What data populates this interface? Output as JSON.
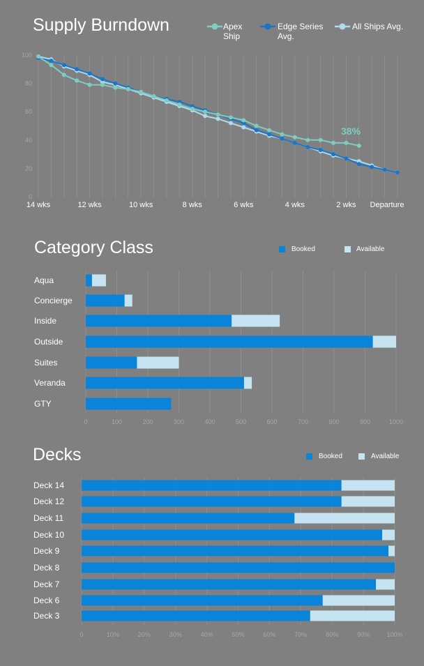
{
  "colors": {
    "background": "#808080",
    "apex": "#7ecdc0",
    "edge": "#1b75c9",
    "all_ships": "#aedbee",
    "booked": "#0984d8",
    "available": "#c5e3f1",
    "grid": "#8e8e8e",
    "tick_text": "#a7a7a7",
    "label_text": "#ffffff"
  },
  "icons": {
    "legend_line_marker": "circle-line-icon",
    "legend_bar_marker": "square-icon"
  },
  "burndown": {
    "title": "Supply Burndown",
    "callout": "38%",
    "legend": [
      {
        "label_line1": "Apex",
        "label_line2": "Ship"
      },
      {
        "label_line1": "Edge Series",
        "label_line2": "Avg."
      },
      {
        "label_line1": "All Ships Avg.",
        "label_line2": ""
      }
    ]
  },
  "category": {
    "title": "Category Class",
    "legend": {
      "booked": "Booked",
      "available": "Available"
    }
  },
  "decks": {
    "title": "Decks",
    "legend": {
      "booked": "Booked",
      "available": "Available"
    }
  },
  "chart_data": [
    {
      "type": "line",
      "title": "Supply Burndown",
      "x_ticks": [
        "14 wks",
        "12 wks",
        "10 wks",
        "8 wks",
        "6 wks",
        "4 wks",
        "2 wks",
        "Departure"
      ],
      "ylim": [
        0,
        100
      ],
      "y_ticks": [
        0,
        20,
        40,
        60,
        80,
        100
      ],
      "x_unit": "weeks before departure",
      "grid": "vertical",
      "annotation": "38%",
      "series": [
        {
          "name": "Apex Ship",
          "color": "#7ecdc0",
          "x": [
            14,
            13.5,
            13,
            12.5,
            12,
            11.5,
            11,
            10.5,
            10,
            9.5,
            9,
            8.5,
            8,
            7.5,
            7,
            6.5,
            6,
            5.5,
            5,
            4.5,
            4,
            3.5,
            3,
            2.5,
            2,
            1.5
          ],
          "y": [
            99,
            93,
            86,
            82,
            79,
            79,
            77,
            76,
            74,
            71,
            68,
            65,
            62,
            60,
            58,
            56,
            54,
            50,
            47,
            44,
            42,
            40,
            40,
            38,
            38,
            36
          ]
        },
        {
          "name": "Edge Series Avg.",
          "color": "#1b75c9",
          "x": [
            14,
            13.5,
            13,
            12.5,
            12,
            11.5,
            11,
            10.5,
            10,
            9.5,
            9,
            8.5,
            8,
            7.5,
            7,
            6.5,
            6,
            5.5,
            5,
            4.5,
            4,
            3.5,
            3,
            2.5,
            2,
            1.5,
            1,
            0.5,
            0
          ],
          "y": [
            98,
            96,
            93,
            90,
            87,
            83,
            80,
            77,
            74,
            71,
            69,
            67,
            64,
            61,
            58,
            55,
            52,
            47,
            44,
            41,
            38,
            35,
            33,
            30,
            27,
            23,
            21,
            19,
            17
          ]
        },
        {
          "name": "All Ships Avg.",
          "color": "#aedbee",
          "x": [
            14,
            13.5,
            13,
            12.5,
            12,
            11.5,
            11,
            10.5,
            10,
            9.5,
            9,
            8.5,
            8,
            7.5,
            7,
            6.5,
            6,
            5.5,
            5,
            4.5,
            4,
            3.5,
            3,
            2.5,
            2,
            1.5,
            1,
            0.5,
            0
          ],
          "y": [
            99,
            97,
            92,
            89,
            86,
            81,
            79,
            76,
            73,
            70,
            67,
            64,
            61,
            57,
            55,
            52,
            49,
            46,
            43,
            41,
            38,
            35,
            32,
            29,
            27,
            25,
            22,
            19,
            17
          ]
        }
      ]
    },
    {
      "type": "bar",
      "orientation": "horizontal",
      "stacked": true,
      "title": "Category Class",
      "categories": [
        "Aqua",
        "Concierge",
        "Inside",
        "Outside",
        "Suites",
        "Veranda",
        "GTY"
      ],
      "xlim": [
        0,
        1000
      ],
      "x_ticks": [
        "0",
        "100",
        "200",
        "300",
        "400",
        "500",
        "600",
        "700",
        "800",
        "900",
        "1000"
      ],
      "series": [
        {
          "name": "Booked",
          "color": "#0984d8",
          "values": [
            20,
            125,
            470,
            925,
            165,
            510,
            275
          ]
        },
        {
          "name": "Available",
          "color": "#c5e3f1",
          "values": [
            45,
            25,
            155,
            75,
            135,
            25,
            0
          ]
        }
      ]
    },
    {
      "type": "bar",
      "orientation": "horizontal",
      "stacked": true,
      "title": "Decks",
      "categories": [
        "Deck 14",
        "Deck 12",
        "Deck 11",
        "Deck 10",
        "Deck 9",
        "Deck 8",
        "Deck 7",
        "Deck 6",
        "Deck 3"
      ],
      "xlim": [
        0,
        100
      ],
      "x_ticks": [
        "0",
        "10%",
        "20%",
        "30%",
        "40%",
        "50%",
        "60%",
        "70%",
        "80%",
        "90%",
        "100%"
      ],
      "series": [
        {
          "name": "Booked",
          "color": "#0984d8",
          "values": [
            83,
            83,
            68,
            96,
            98,
            100,
            94,
            77,
            73
          ]
        },
        {
          "name": "Available",
          "color": "#c5e3f1",
          "values": [
            17,
            17,
            32,
            4,
            2,
            0,
            6,
            23,
            27
          ]
        }
      ]
    }
  ]
}
